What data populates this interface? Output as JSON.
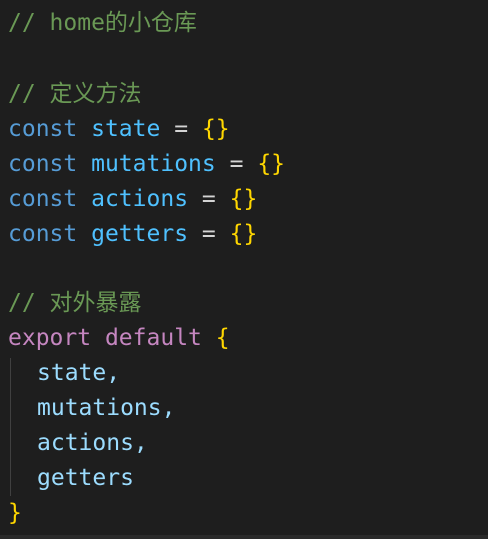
{
  "editor": {
    "lines": {
      "comment_home": "// home的小仓库",
      "comment_define": "// 定义方法",
      "comment_export": "// 对外暴露",
      "state_decl": {
        "kw": "const",
        "name": "state",
        "op": "=",
        "val": "{}"
      },
      "mutations_decl": {
        "kw": "const",
        "name": "mutations",
        "op": "=",
        "val": "{}"
      },
      "actions_decl": {
        "kw": "const",
        "name": "actions",
        "op": "=",
        "val": "{}"
      },
      "getters_decl": {
        "kw": "const",
        "name": "getters",
        "op": "=",
        "val": "{}"
      },
      "export_line": {
        "kw1": "export",
        "kw2": "default",
        "brace": "{"
      },
      "export_items": [
        "state,",
        "mutations,",
        "actions,",
        "getters"
      ],
      "close_brace": "}"
    }
  }
}
